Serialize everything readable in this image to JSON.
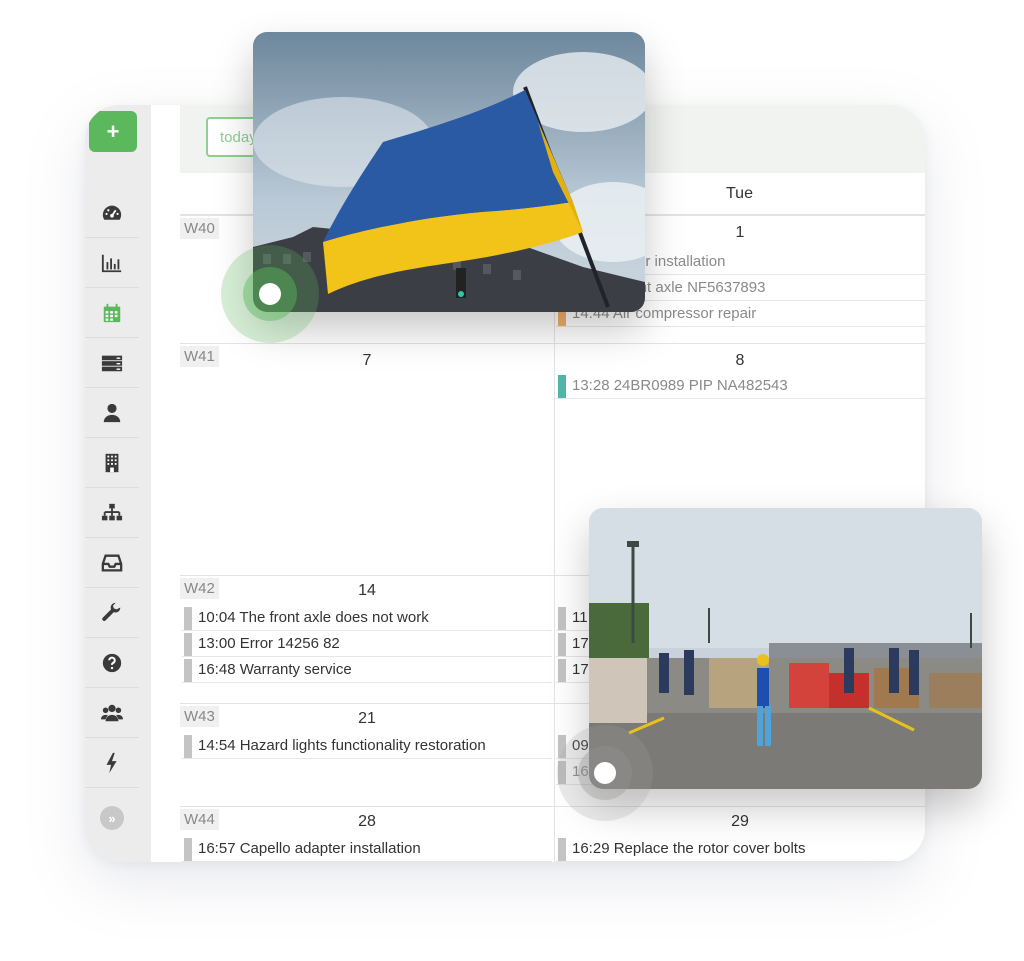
{
  "sidebar": {
    "add_label": "+",
    "collapse_label": "»",
    "items": [
      {
        "icon": "dashboard-icon"
      },
      {
        "icon": "bar-chart-icon"
      },
      {
        "icon": "calendar-icon",
        "active": true
      },
      {
        "icon": "server-icon"
      },
      {
        "icon": "user-icon"
      },
      {
        "icon": "building-icon"
      },
      {
        "icon": "org-chart-icon"
      },
      {
        "icon": "inbox-icon"
      },
      {
        "icon": "wrench-icon"
      },
      {
        "icon": "help-icon"
      },
      {
        "icon": "users-icon"
      },
      {
        "icon": "bolt-icon"
      }
    ]
  },
  "toolbar": {
    "today_label": "today"
  },
  "calendar": {
    "headers": [
      "",
      "Tue"
    ],
    "weeks": [
      {
        "label": "W40",
        "day1": "",
        "day2": "1",
        "events1": [],
        "events2": [
          {
            "text": "ello adapter installation",
            "color": "#c4c4c4",
            "muted": true
          },
          {
            "text": "ect the front axle NF5637893",
            "color": "#c4c4c4",
            "muted": true
          },
          {
            "text": "14:44 Air compressor repair",
            "color": "#f5b06a",
            "muted": true
          }
        ]
      },
      {
        "label": "W41",
        "day1": "7",
        "day2": "8",
        "events1": [],
        "events2": [
          {
            "text": "13:28 24BR0989 PIP NA482543",
            "color": "#4fb5a8",
            "muted": true
          }
        ]
      },
      {
        "label": "W42",
        "day1": "14",
        "day2": "",
        "events1": [
          {
            "text": "10:04 The front axle does not work",
            "color": "#c4c4c4"
          },
          {
            "text": "13:00 Error 14256 82",
            "color": "#c4c4c4"
          },
          {
            "text": "16:48 Warranty service",
            "color": "#c4c4c4"
          }
        ],
        "events2": [
          {
            "text": "11",
            "color": "#c4c4c4"
          },
          {
            "text": "17",
            "color": "#c4c4c4"
          },
          {
            "text": "17",
            "color": "#c4c4c4"
          }
        ]
      },
      {
        "label": "W43",
        "day1": "21",
        "day2": "",
        "events1": [
          {
            "text": "14:54 Hazard lights functionality restoration",
            "color": "#c4c4c4"
          }
        ],
        "events2": [
          {
            "text": "09",
            "color": "#c4c4c4"
          },
          {
            "text": "16",
            "color": "#c4c4c4",
            "muted": true
          }
        ]
      },
      {
        "label": "W44",
        "day1": "28",
        "day2": "29",
        "events1": [
          {
            "text": "16:57 Capello adapter installation",
            "color": "#c4c4c4"
          }
        ],
        "events2": [
          {
            "text": "16:29 Replace the rotor cover bolts",
            "color": "#c4c4c4"
          }
        ]
      }
    ]
  },
  "colors": {
    "accent_green": "#5cb85c",
    "flag_blue": "#2a5aa3",
    "flag_yellow": "#f2c318"
  },
  "overlays": [
    {
      "icon": "ukraine-flag-photo"
    },
    {
      "icon": "volunteers-parking-lot-photo"
    }
  ]
}
